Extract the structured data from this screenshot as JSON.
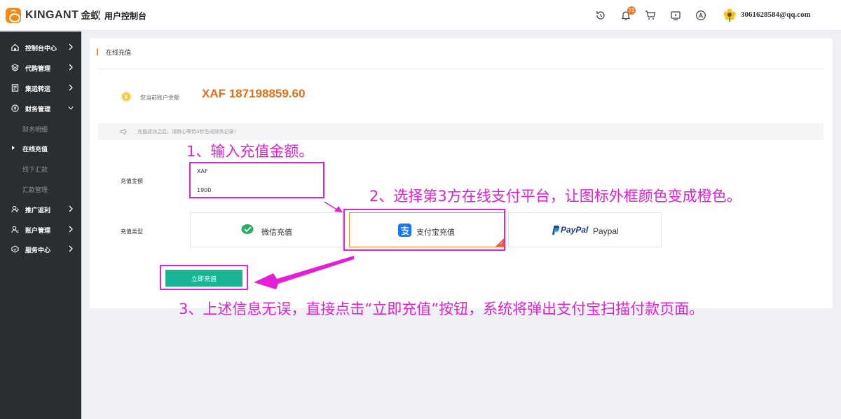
{
  "header": {
    "brand": "KINGANT",
    "brand_cn": "金蚁",
    "title": "用户控制台",
    "notification_count": "75",
    "user_email": "3061628584@qq.com",
    "icons": [
      "refresh-icon",
      "bell-icon",
      "cart-icon",
      "monitor-icon",
      "a-circle-icon"
    ]
  },
  "sidebar": {
    "items": [
      {
        "label": "控制台中心",
        "icon": "home-icon"
      },
      {
        "label": "代购管理",
        "icon": "layers-icon"
      },
      {
        "label": "集运转运",
        "icon": "document-icon"
      },
      {
        "label": "财务管理",
        "icon": "yen-circle-icon",
        "expanded": true
      },
      {
        "label": "推广返利",
        "icon": "user-share-icon"
      },
      {
        "label": "账户管理",
        "icon": "user-icon"
      },
      {
        "label": "服务中心",
        "icon": "service-icon"
      }
    ],
    "finance_sub": [
      {
        "label": "财务明细"
      },
      {
        "label": "在线充值",
        "active": true
      },
      {
        "label": "线下汇款"
      },
      {
        "label": "汇款管理"
      }
    ]
  },
  "main": {
    "section_title": "在线充值",
    "balance_label": "您当前账户余额",
    "balance_value": "XAF 187198859.60",
    "notice": "充值成功之后，请耐心等待3秒生成财务记录！",
    "amount_label": "充值金额",
    "currency": "XAF",
    "amount": "1900",
    "type_label": "充值类型",
    "payment_options": [
      {
        "label": "微信充值",
        "icon": "wechat-icon",
        "selected": false
      },
      {
        "label": "支付宝充值",
        "icon": "alipay-icon",
        "selected": true
      },
      {
        "label": "Paypal",
        "logo_text": "PayPal",
        "icon": "paypal-icon",
        "selected": false
      }
    ],
    "submit_label": "立即充值"
  },
  "annotations": {
    "step1": "1、输入充值金额。",
    "step2": "2、选择第3方在线支付平台，让图标外框颜色变成橙色。",
    "step3": "3、上述信息无误，直接点击“立即充值”按钮，系统将弹出支付宝扫描付款页面。"
  },
  "colors": {
    "accent_orange": "#f08b2a",
    "balance_orange": "#e0701a",
    "button_green": "#1ab394",
    "sidebar_bg": "#2a2d32",
    "annotation_magenta": "#e51fd6"
  }
}
